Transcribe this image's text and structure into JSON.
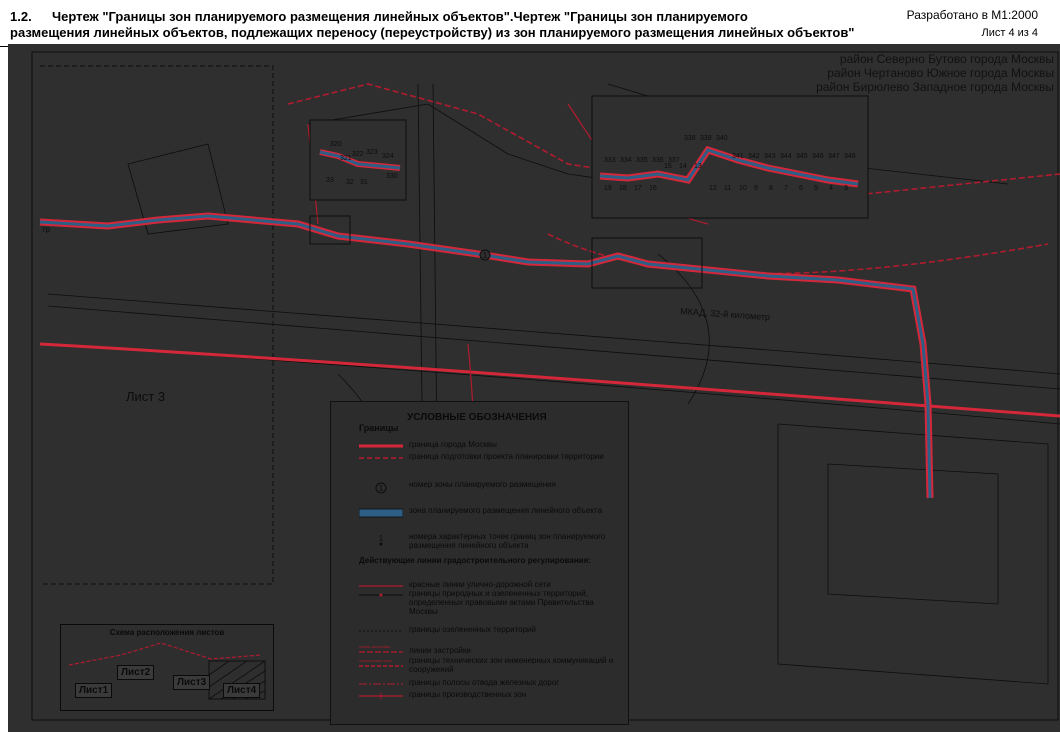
{
  "header": {
    "number": "1.2.",
    "title_line1": "Чертеж \"Границы зон планируемого размещения линейных объектов\".Чертеж \"Границы зон планируемого",
    "title_line2": "размещения линейных объектов, подлежащих переносу (переустройству) из зон планируемого размещения линейных объектов\"",
    "scale": "Разработано в М1:2000",
    "sheet": "Лист 4 из 4"
  },
  "districts": [
    "район Северно Бутово города Москвы",
    "район Чертаново Южное города Москвы",
    "район Бирюлево Западное города Москвы"
  ],
  "map_labels": {
    "sheet3": "Лист 3",
    "mkad": "МКАД, 32-й километр",
    "zone_number": "1",
    "road_left": "тр",
    "top_points": [
      "333",
      "334",
      "335",
      "336",
      "337",
      "338",
      "339",
      "340",
      "341",
      "342",
      "343",
      "344",
      "345",
      "346",
      "347",
      "348"
    ],
    "top_sub": [
      "19",
      "18",
      "17",
      "16",
      "15",
      "14",
      "13",
      "12",
      "11",
      "10",
      "9",
      "8",
      "7",
      "6",
      "5",
      "4",
      "3"
    ],
    "left_points": [
      "320",
      "321",
      "322",
      "323",
      "324",
      "330",
      "33",
      "32",
      "31"
    ]
  },
  "legend": {
    "title": "УСЛОВНЫЕ ОБОЗНАЧЕНИЯ",
    "boundaries_heading": "Границы",
    "items": [
      {
        "label": "граница города Москвы"
      },
      {
        "label": "граница подготовки проекта планировки территории"
      },
      {
        "label": "номер зоны планируемого размещения",
        "symbol": "1"
      },
      {
        "label": "зона планируемого размещения линейного объекта"
      },
      {
        "label": "номера характерных точек границ зон планируемого размещения линейного объекта",
        "symbol": "1"
      }
    ],
    "reg_heading": "Действующие линии градостроительного регулирования:",
    "reg_items": [
      {
        "label": "красные линии улично-дорожной сети"
      },
      {
        "label": "границы природных и озелененных территорий, определенных правовыми актами Правительства Москвы"
      },
      {
        "label": "границы озелененных территорий"
      },
      {
        "label": "линии застройки",
        "symbol": "линия застройки"
      },
      {
        "label": "границы технических зон инженерных коммуникаций и сооружений",
        "symbol": "техническая зона"
      },
      {
        "label": "границы полосы отвода железных дорог"
      },
      {
        "label": "границы производственных зон"
      }
    ]
  },
  "scheme": {
    "title": "Схема расположения листов",
    "sheets": [
      "Лист1",
      "Лист2",
      "Лист3",
      "Лист4"
    ]
  },
  "colors": {
    "map_background": "#2f2f2f",
    "moscow_boundary": "#d4283a",
    "planning_boundary": "#b01c2e",
    "zone_fill": "#2d5f86",
    "linework": "#0d0d0d"
  }
}
